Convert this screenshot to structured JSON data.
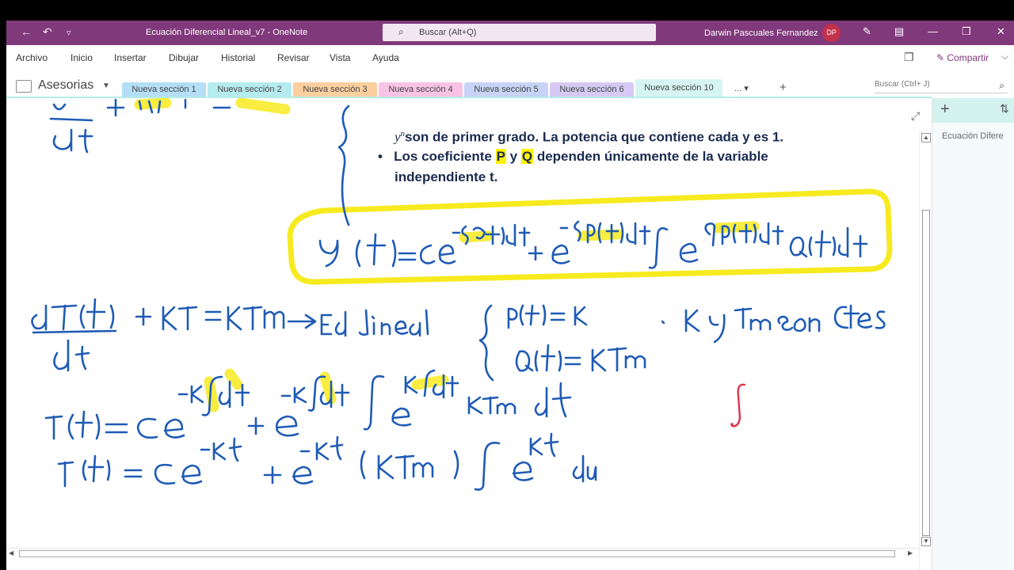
{
  "titlebar": {
    "document_title": "Ecuación Diferencial Lineal_v7  -  OneNote",
    "search_placeholder": "Buscar (Alt+Q)",
    "user_name": "Darwin Pascuales Fernandez",
    "user_initials": "DP",
    "icons": [
      "back-icon",
      "undo-icon",
      "customize-icon",
      "pen-icon",
      "ribbon-display-icon",
      "minimize-icon",
      "maximize-icon",
      "close-icon"
    ]
  },
  "ribbon": {
    "tabs": [
      "Archivo",
      "Inicio",
      "Insertar",
      "Dibujar",
      "Historial",
      "Revisar",
      "Vista",
      "Ayuda"
    ],
    "share_label": "Compartir"
  },
  "notebook": {
    "name": "Asesorias",
    "sections": [
      {
        "label": "Nueva sección 1",
        "color": "#b4dff7"
      },
      {
        "label": "Nueva sección 2",
        "color": "#b6ecf0"
      },
      {
        "label": "Nueva sección 3",
        "color": "#fbcf9e"
      },
      {
        "label": "Nueva sección 4",
        "color": "#f8c3e5"
      },
      {
        "label": "Nueva sección 5",
        "color": "#c7d3f7"
      },
      {
        "label": "Nueva sección 6",
        "color": "#d6c9f3"
      },
      {
        "label": "Nueva sección 10",
        "color": "#d6f5f2",
        "active": true
      }
    ],
    "more_label": "...",
    "page_search_placeholder": "Buscar (Ctrl+ J)"
  },
  "note": {
    "line1_prefix": "y",
    "line1_sup": "n",
    "line1_text": "son de primer grado. La potencia que contiene cada y es 1.",
    "bullet_a": "Los coeficiente ",
    "bullet_p": "P",
    "bullet_y": " y ",
    "bullet_q": "Q",
    "bullet_b": " dependen únicamente de la variable",
    "bullet_line2": "independiente t.",
    "handwriting": {
      "formula_general": "y(t) = Ce^(-∫P(t)dt) + e^(-∫P(t)dt) ∫ e^(∫P(t)dt) Q(t) dt",
      "ode": "dT(t)/dt + KT = KTm",
      "arrow_note": "→ Ed lineal",
      "p_def": "P(t) = K",
      "q_def": "Q(t) = KTm",
      "constants_note": ", K y Tm son ctes",
      "step1": "T(t) = Ce^(-K∫dt) + e^(-K∫dt) ∫ e^(K∫dt) KTm dt",
      "step2": "T(t) = Ce^(-Kt) + e^(-Kt) (KTm) ∫ e^(Kt) du"
    }
  },
  "pages_pane": {
    "page_title": "Ecuación Difere"
  }
}
